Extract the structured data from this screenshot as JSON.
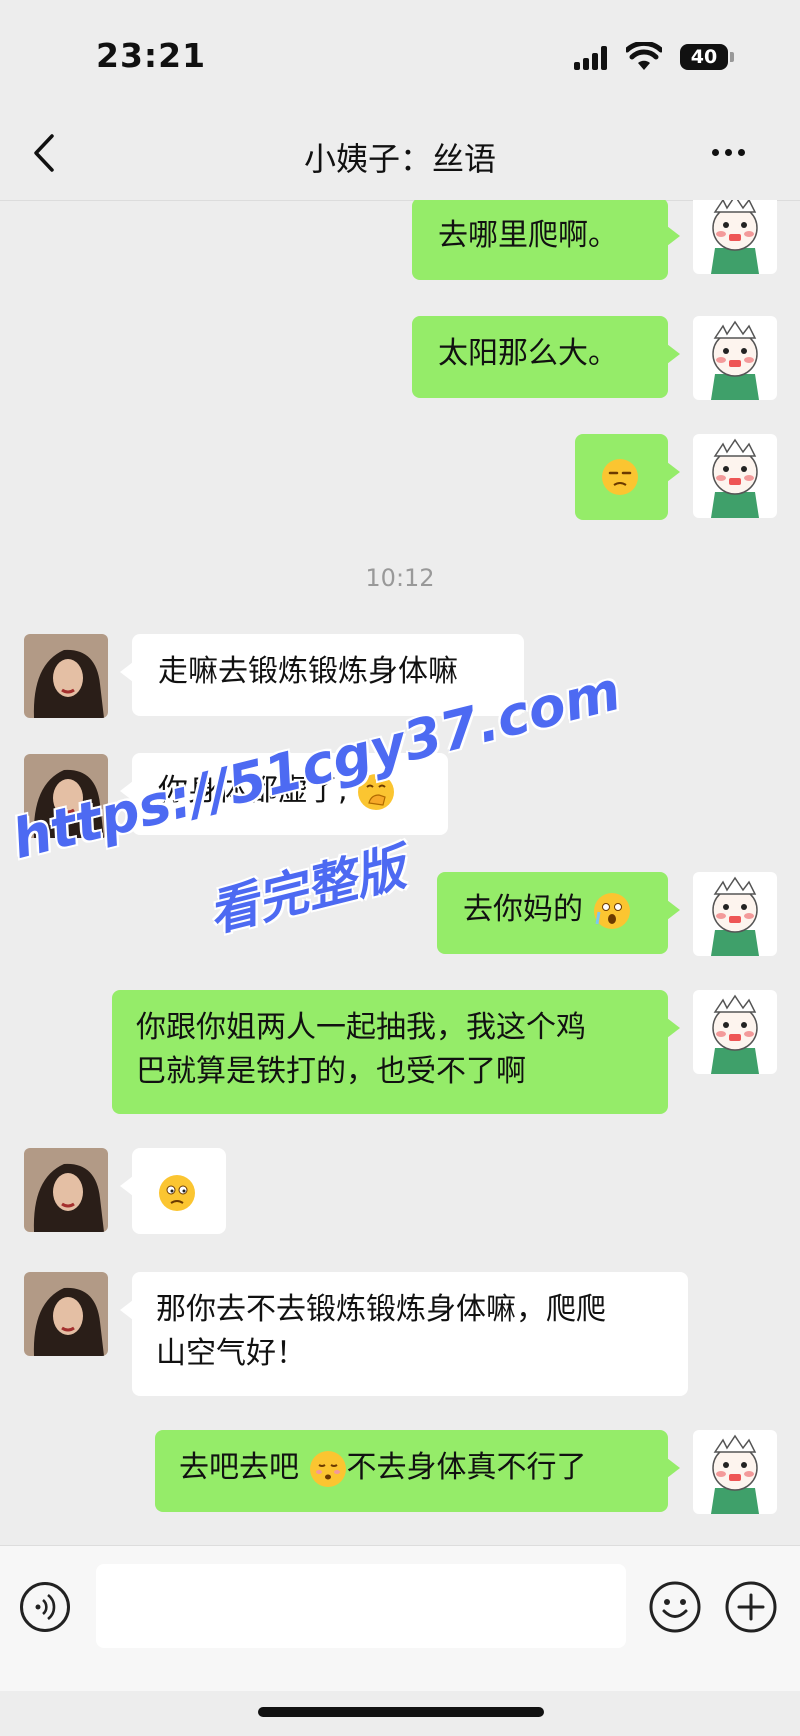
{
  "status_bar": {
    "time": "23:21",
    "battery": "40"
  },
  "nav": {
    "title": "小姨子：丝语"
  },
  "messages": [
    {
      "from": "me",
      "text": "去哪里爬啊。"
    },
    {
      "from": "me",
      "text": "太阳那么大。"
    },
    {
      "from": "me",
      "emoji": "unamused-face"
    },
    {
      "timestamp": "10:12"
    },
    {
      "from": "them",
      "text": "走嘛去锻炼锻炼身体嘛"
    },
    {
      "from": "them",
      "text": "你身体都虚了,",
      "emoji": "hand-over-mouth-face"
    },
    {
      "from": "me",
      "text": "去你妈的",
      "emoji": "shocked-face"
    },
    {
      "from": "me",
      "lines": [
        "你跟你姐两人一起抽我，我这个鸡",
        "巴就算是铁打的，也受不了啊"
      ]
    },
    {
      "from": "them",
      "emoji": "worried-face"
    },
    {
      "from": "them",
      "lines": [
        "那你去不去锻炼锻炼身体嘛，爬爬",
        "山空气好！"
      ]
    },
    {
      "from": "me",
      "text_before": "去吧去吧 ",
      "emoji": "pleading-face",
      "text_after": "不去身体真不行了"
    }
  ],
  "watermark": {
    "url": "https://51cgy37.com",
    "sub": "看完整版"
  },
  "input": {
    "placeholder": ""
  },
  "colors": {
    "my_bubble": "#95ec69",
    "their_bubble": "#ffffff",
    "background": "#ededed",
    "watermark": "#4d6af2"
  }
}
